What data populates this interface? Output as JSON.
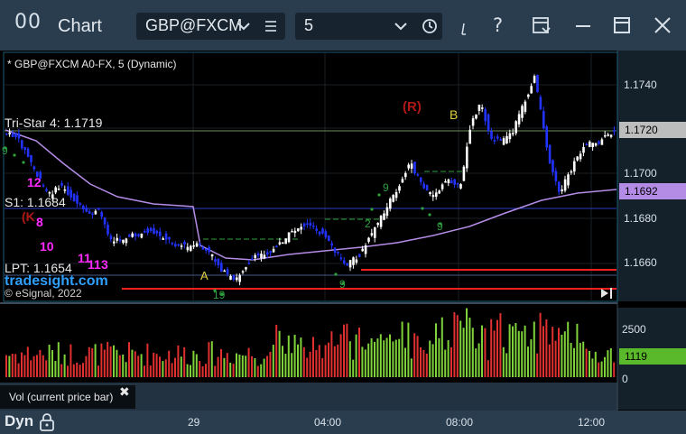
{
  "toolbar": {
    "logo": "00",
    "title": "Chart",
    "symbol_value": "GBP@FXCM",
    "interval_value": "5",
    "help_label": "?"
  },
  "chart": {
    "header": "* GBP@FXCM A0-FX, 5 (Dynamic)",
    "tristar_label": "Tri-Star 4: 1.1719",
    "s1_label": "S1: 1.1684",
    "lpt_label": "LPT: 1.1654",
    "brand": "tradesight.com",
    "copyright": "© eSignal, 2022",
    "marker_R": "(R)",
    "marker_B": "B",
    "marker_A": "A",
    "price_axis": [
      {
        "label": "1.1740",
        "value": 1.174
      },
      {
        "label": "1.1700",
        "value": 1.17
      },
      {
        "label": "1.1680",
        "value": 1.168
      },
      {
        "label": "1.1660",
        "value": 1.166
      }
    ],
    "last_price": "1.1720",
    "ma_price": "1.1692",
    "volume_axis": [
      "2500",
      "0"
    ],
    "last_volume": "1119",
    "volume_legend": "Vol (current price bar)",
    "time_axis": [
      "29",
      "04:00",
      "08:00",
      "12:00"
    ]
  },
  "footer": {
    "mode": "Dyn"
  },
  "colors": {
    "up_candle": "#ffffff",
    "down_candle": "#2233ff",
    "moving_average": "#b48ce6",
    "tristar_line": "#6d8f5a",
    "s1_line": "#2b3cc8",
    "lpt_line": "#ff2020",
    "vol_up": "#7fd23a",
    "vol_down": "#e03030",
    "last_volume_bg": "#5ab92a"
  }
}
